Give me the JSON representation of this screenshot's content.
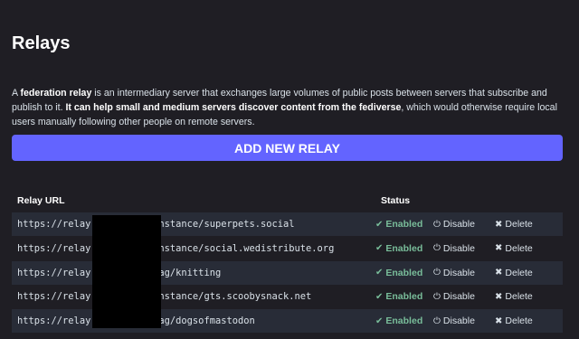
{
  "page": {
    "title": "Relays",
    "intro": {
      "part1": "A ",
      "bold1": "federation relay",
      "part2": " is an intermediary server that exchanges large volumes of public posts between servers that subscribe and publish to it. ",
      "bold2": "It can help small and medium servers discover content from the fediverse",
      "part3": ", which would otherwise require local users manually following other people on remote servers."
    },
    "add_button_label": "ADD NEW RELAY"
  },
  "table": {
    "headers": {
      "url": "Relay URL",
      "status": "Status"
    },
    "rows": [
      {
        "url": "https://relay.fedi.buzz/instance/superpets.social",
        "status": "Enabled",
        "disable": "Disable",
        "delete": "Delete"
      },
      {
        "url": "https://relay.fedi.buzz/instance/social.wedistribute.org",
        "status": "Enabled",
        "disable": "Disable",
        "delete": "Delete"
      },
      {
        "url": "https://relay.fedi.buzz/tag/knitting",
        "status": "Enabled",
        "disable": "Disable",
        "delete": "Delete"
      },
      {
        "url": "https://relay.fedi.buzz/instance/gts.scoobysnack.net",
        "status": "Enabled",
        "disable": "Disable",
        "delete": "Delete"
      },
      {
        "url": "https://relay.fedi.buzz/tag/dogsofmastodon",
        "status": "Enabled",
        "disable": "Disable",
        "delete": "Delete"
      }
    ]
  },
  "colors": {
    "background": "#1f1e24",
    "accent": "#6364ff",
    "enabled": "#79bd9a",
    "row_alt": "#282c37"
  },
  "icons": {
    "status": "check-icon",
    "disable": "power-icon",
    "delete": "x-icon"
  }
}
